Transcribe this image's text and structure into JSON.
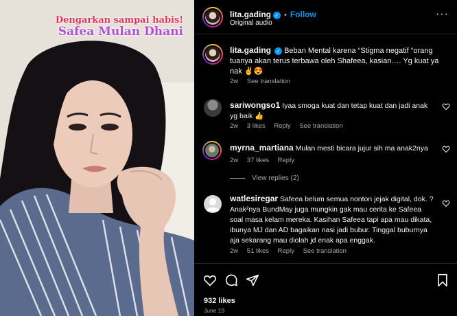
{
  "media": {
    "overlay_line1": "Dengarkan sampai habis!",
    "overlay_line2": "Safea Mulan Dhani"
  },
  "header": {
    "username": "lita.gading",
    "verified_icon": "verified-badge-icon",
    "separator": "•",
    "follow_label": "Follow",
    "audio_label": "Original audio",
    "more_label": "···"
  },
  "caption": {
    "username": "lita.gading",
    "text": "Beban Mental karena “Stigma negatif “orang tuanya akan terus terbawa oleh Shafeea, kasian…. Yg kuat ya nak ✌️😍",
    "time": "2w",
    "see_translation": "See translation"
  },
  "comments": [
    {
      "username": "sariwongso1",
      "text": "Iyaa smoga kuat dan tetap kuat dan jadi anak yg baik 👍",
      "time": "2w",
      "likes": "3 likes",
      "reply": "Reply",
      "see_translation": "See translation"
    },
    {
      "username": "myrna_martiana",
      "text": "Mulan mesti bicara jujur sih ma anak2nya",
      "time": "2w",
      "likes": "37 likes",
      "reply": "Reply",
      "view_replies": "View replies (2)"
    },
    {
      "username": "watlesiregar",
      "text": "Safeea belum semua nonton jejak digital, dok. ? Anak²nya BundMay juga mungkin gak mau cerita ke Safeea soal masa kelam mereka. Kasihan Safeea tapi apa mau dikata, ibunya MJ dan AD bagaikan nasi jadi bubur. Tinggal buburnya aja sekarang mau diolah jd enak apa enggak.",
      "time": "2w",
      "likes": "51 likes",
      "reply": "Reply",
      "see_translation": "See translation"
    }
  ],
  "actions": {
    "icons": [
      "heart-icon",
      "comment-icon",
      "share-icon",
      "bookmark-icon"
    ],
    "likes_count": "932 likes",
    "date": "June 19"
  },
  "colors": {
    "accent": "#0095f6",
    "muted": "#a8a8a8",
    "overlay_red": "#e0315a",
    "overlay_purple": "#b24fd1"
  }
}
